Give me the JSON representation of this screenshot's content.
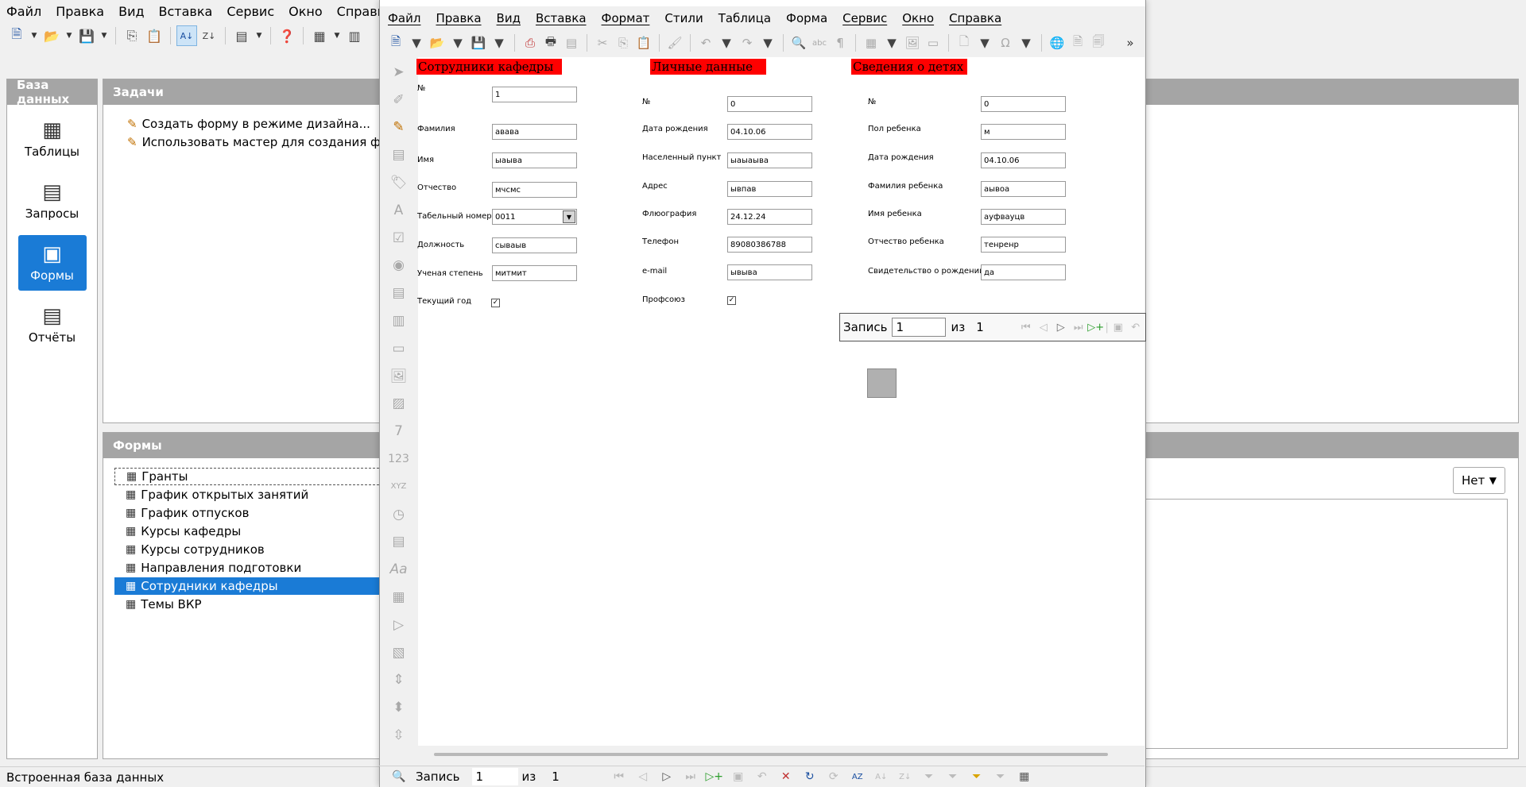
{
  "base": {
    "menu": [
      "Файл",
      "Правка",
      "Вид",
      "Вставка",
      "Сервис",
      "Окно",
      "Справка"
    ],
    "left_panel": {
      "title": "База данных",
      "items": [
        {
          "label": "Таблицы",
          "icon": "table-icon"
        },
        {
          "label": "Запросы",
          "icon": "query-icon"
        },
        {
          "label": "Формы",
          "icon": "form-icon",
          "selected": true
        },
        {
          "label": "Отчёты",
          "icon": "report-icon"
        }
      ]
    },
    "tasks": {
      "title": "Задачи",
      "items": [
        "Создать форму в режиме дизайна...",
        "Использовать мастер для создания формы..."
      ]
    },
    "forms": {
      "title": "Формы",
      "items": [
        "Гранты",
        "График открытых занятий",
        "График отпусков",
        "Курсы кафедры",
        "Курсы сотрудников",
        "Направления подготовки",
        "Сотрудники кафедры",
        "Темы ВКР"
      ],
      "selected_index": 6,
      "focused_index": 0
    },
    "preview_select": "Нет",
    "status": "Встроенная база данных"
  },
  "form_window": {
    "menu": [
      "Файл",
      "Правка",
      "Вид",
      "Вставка",
      "Формат",
      "Стили",
      "Таблица",
      "Форма",
      "Сервис",
      "Окно",
      "Справка"
    ],
    "sections": {
      "employee": {
        "title": "Сотрудники кафедры",
        "fields": [
          {
            "label": "№",
            "value": "1"
          },
          {
            "label": "Фамилия",
            "value": "авава"
          },
          {
            "label": "Имя",
            "value": "ыаыва"
          },
          {
            "label": "Отчество",
            "value": "мчсмс"
          },
          {
            "label": "Табельный номер",
            "value": "0011"
          },
          {
            "label": "Должность",
            "value": "сываыв"
          },
          {
            "label": "Ученая степень",
            "value": "митмит"
          }
        ],
        "checkbox": {
          "label": "Текущий год",
          "checked": true
        }
      },
      "personal": {
        "title": "Личные данные",
        "fields": [
          {
            "label": "№",
            "value": "0"
          },
          {
            "label": "Дата рождения",
            "value": "04.10.06"
          },
          {
            "label": "Населенный пункт",
            "value": "ыаыаыва"
          },
          {
            "label": "Адрес",
            "value": "ывпав"
          },
          {
            "label": "Флюография",
            "value": "24.12.24"
          },
          {
            "label": "Телефон",
            "value": "89080386788"
          },
          {
            "label": "e-mail",
            "value": "ывыва"
          }
        ],
        "checkbox": {
          "label": "Профсоюз",
          "checked": true
        }
      },
      "children": {
        "title": "Сведения о детях",
        "fields": [
          {
            "label": "№",
            "value": "0"
          },
          {
            "label": "Пол ребенка",
            "value": "м"
          },
          {
            "label": "Дата рождения",
            "value": "04.10.06"
          },
          {
            "label": "Фамилия ребенка",
            "value": "аывоа"
          },
          {
            "label": "Имя ребенка",
            "value": "ауфвауцв"
          },
          {
            "label": "Отчество ребенка",
            "value": "тенренр"
          },
          {
            "label": "Свидетельство о рождении",
            "value": "да"
          }
        ]
      }
    },
    "subnav": {
      "label": "Запись",
      "value": "1",
      "of": "из",
      "total": "1"
    },
    "bottom_nav": {
      "label": "Запись",
      "value": "1",
      "of": "из",
      "total": "1"
    }
  }
}
